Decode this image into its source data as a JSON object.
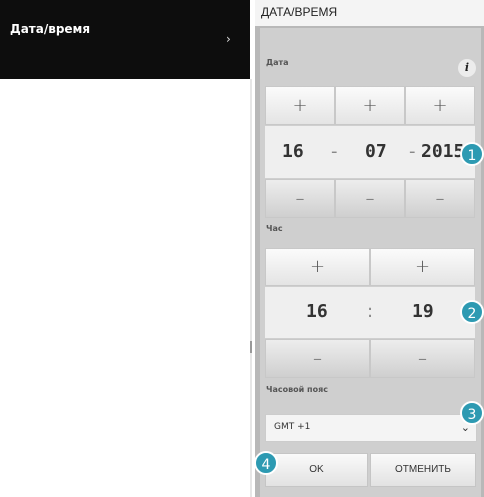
{
  "nav": {
    "label": "Дата/время",
    "chevron": "›"
  },
  "panel": {
    "title": "ДАТА/ВРЕМЯ"
  },
  "date": {
    "label": "Дата",
    "info_icon": "i",
    "day": "16",
    "month": "07",
    "year": "2015",
    "sep1": "-",
    "sep2": "-",
    "plus": "+",
    "minus": "–"
  },
  "time": {
    "label": "Час",
    "hour": "16",
    "minute": "19",
    "sep": ":",
    "plus": "+",
    "minus": "–"
  },
  "timezone": {
    "label": "Часовой пояс",
    "value": "GMT +1",
    "chevron": "⌄"
  },
  "actions": {
    "ok_label": "OK",
    "cancel_label": "ОТМЕНИТЬ"
  },
  "badges": [
    "1",
    "2",
    "3",
    "4"
  ],
  "colors": {
    "badge": "#2d9ab2",
    "nav_bg": "#0d0d0d"
  }
}
